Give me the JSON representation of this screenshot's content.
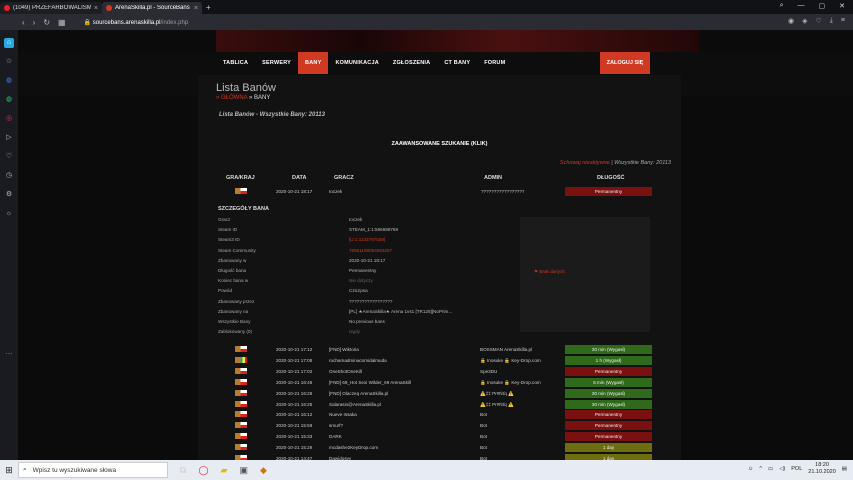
{
  "browser": {
    "tabs": [
      {
        "title": "(1049) PRZEFARBOWALIŚM",
        "close": "×"
      },
      {
        "title": "ArenaSkilla.pl - SourceBans",
        "close": "×"
      }
    ],
    "new_tab": "+",
    "url_domain": "sourcebans.arenaskilla.pl",
    "url_path": "/index.php"
  },
  "site": {
    "menu": [
      "TABLICA",
      "SERWERY",
      "BANY",
      "KOMUNIKACJA",
      "ZGŁOSZENIA",
      "CT BANY",
      "FORUM"
    ],
    "active_menu": "BANY",
    "login": "ZALOGUJ SIĘ",
    "page_title": "Lista Banów",
    "breadcrumb_home": "» GŁÓWNA",
    "breadcrumb_current": "» BANY",
    "subtitle": "Lista Banów - Wszystkie Bany: 20113",
    "advanced_search": "ZAAWANSOWANE SZUKANIE (KLIK)",
    "hide_inactive": "Schowaj nieaktywne",
    "total_label": "| Wszystkie Bany: 20113"
  },
  "table": {
    "headers": [
      "GRA/KRAJ",
      "DATA",
      "GRACZ",
      "ADMIN",
      "DŁUGOŚĆ"
    ],
    "first_row": {
      "date": "2020-10-21 18:17",
      "player": "Ioczek",
      "admin": "?????????????????",
      "length": "Permanentny"
    },
    "details_title": "SZCZEGÓŁY BANA",
    "details": [
      {
        "k": "Gracz",
        "v": "Ioczek",
        "style": ""
      },
      {
        "k": "Steam ID",
        "v": "STEAM_1:1:566698769",
        "style": ""
      },
      {
        "k": "Steam3 ID",
        "v": "[U:1:1133797539]",
        "style": "red"
      },
      {
        "k": "Steam Community",
        "v": "76561199094063267",
        "style": "red"
      },
      {
        "k": "Zbanowany w",
        "v": "2020-10-21 18:17",
        "style": ""
      },
      {
        "k": "Długość bana",
        "v": "Permanentny",
        "style": ""
      },
      {
        "k": "Koniec bana w",
        "v": "Nie dotyczy",
        "style": "dim"
      },
      {
        "k": "Powód",
        "v": "Cziczpsa",
        "style": ""
      },
      {
        "k": "Zbanowany przez",
        "v": "?????????????????",
        "style": ""
      },
      {
        "k": "Zbanowany na",
        "v": "[PL] ★ArenaSkilla★ Arena 1vs1 [TR128][NoPrim...",
        "style": ""
      },
      {
        "k": "Wszystkie Bany",
        "v": "No previous bans",
        "style": ""
      },
      {
        "k": "Zablokowany (0)",
        "v": "nigdy",
        "style": "dim"
      }
    ],
    "action": "Brak danych",
    "rows": [
      {
        "date": "2020-10-21 17:12",
        "player": "[FND] Wiktoria",
        "admin": "BOSSMAN ArenaSkilla.pl",
        "length": "30 min (Wygasł)",
        "kind": "tmp",
        "flag": "fl1"
      },
      {
        "date": "2020-10-21 17:08",
        "player": "ruchamadminacomidalmuda",
        "admin": "🔒 Inosuke 🔒 Key-Drop.com",
        "length": "1 h (Wygasł)",
        "kind": "tmp",
        "flag": "fl2"
      },
      {
        "date": "2020-10-21 17:02",
        "player": "OneShotOneKill",
        "admin": "Spe3DU",
        "length": "Permanentny",
        "kind": "perm",
        "flag": "fl1"
      },
      {
        "date": "2020-10-21 16:46",
        "player": "[FND] 69_Hot Sexi Wilder_69 ArenaSkill",
        "admin": "🔒 Inosuke 🔒 Key-Drop.com",
        "length": "5 min (Wygasł)",
        "kind": "tmp",
        "flag": "fl1"
      },
      {
        "date": "2020-10-21 16:26",
        "player": "[FND] Olaczeq ArenaSkilla.pl",
        "admin": "⚠️‡‡ Pr#Ńťq ⚠️",
        "length": "30 min (Wygasł)",
        "kind": "tmp",
        "flag": "fl1"
      },
      {
        "date": "2020-10-21 16:25",
        "player": "Salarasin@ArenaSkilla.pl",
        "admin": "⚠️‡‡ Pr#Ńťq ⚠️",
        "length": "30 min (Wygasł)",
        "kind": "tmp",
        "flag": "fl1"
      },
      {
        "date": "2020-10-21 16:12",
        "player": "Nueve Issaka",
        "admin": "Bot",
        "length": "Permanentny",
        "kind": "perm",
        "flag": "fl1"
      },
      {
        "date": "2020-10-21 15:59",
        "player": "smurf?",
        "admin": "Bot",
        "length": "Permanentny",
        "kind": "perm",
        "flag": "fl1"
      },
      {
        "date": "2020-10-21 15:33",
        "player": "DARK",
        "admin": "Bot",
        "length": "Permanentny",
        "kind": "perm",
        "flag": "fl1"
      },
      {
        "date": "2020-10-21 15:29",
        "player": "mcdashe2KeyDrop.com",
        "admin": "Bot",
        "length": "1 day",
        "kind": "day",
        "flag": "fl1"
      },
      {
        "date": "2020-10-21 14:47",
        "player": "Dawidosyy",
        "admin": "Bot",
        "length": "1 day",
        "kind": "day",
        "flag": "fl1"
      }
    ]
  },
  "taskbar": {
    "search_placeholder": "Wpisz tu wyszukiwane słowa",
    "lang": "POL",
    "time": "18:20",
    "date": "21.10.2020"
  }
}
